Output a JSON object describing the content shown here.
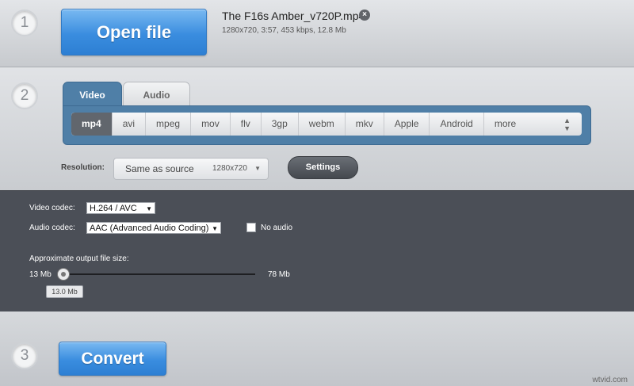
{
  "steps": {
    "one": "1",
    "two": "2",
    "three": "3"
  },
  "file": {
    "open_label": "Open file",
    "name": "The F16s Amber_v720P.mp4",
    "meta": "1280x720, 3:57, 453 kbps, 12.8 Mb",
    "remove_icon": "×"
  },
  "tabs": {
    "video": "Video",
    "audio": "Audio"
  },
  "formats": [
    "mp4",
    "avi",
    "mpeg",
    "mov",
    "flv",
    "3gp",
    "webm",
    "mkv",
    "Apple",
    "Android",
    "more"
  ],
  "formats_selected": "mp4",
  "resolution": {
    "label": "Resolution:",
    "value": "Same as source",
    "dimensions": "1280x720"
  },
  "settings_label": "Settings",
  "codecs": {
    "video_label": "Video codec:",
    "video_value": "H.264 / AVC",
    "audio_label": "Audio codec:",
    "audio_value": "AAC (Advanced Audio Coding)",
    "no_audio_label": "No audio",
    "no_audio_checked": false
  },
  "size": {
    "label": "Approximate output file size:",
    "min": "13 Mb",
    "max": "78 Mb",
    "current": "13.0 Mb",
    "current_fraction": 0.0
  },
  "convert_label": "Convert",
  "watermark": "wtvid.com",
  "colors": {
    "accent_blue": "#3a8ddf",
    "panel_blue": "#4f7fa7",
    "dark_panel": "#4b4f57"
  }
}
